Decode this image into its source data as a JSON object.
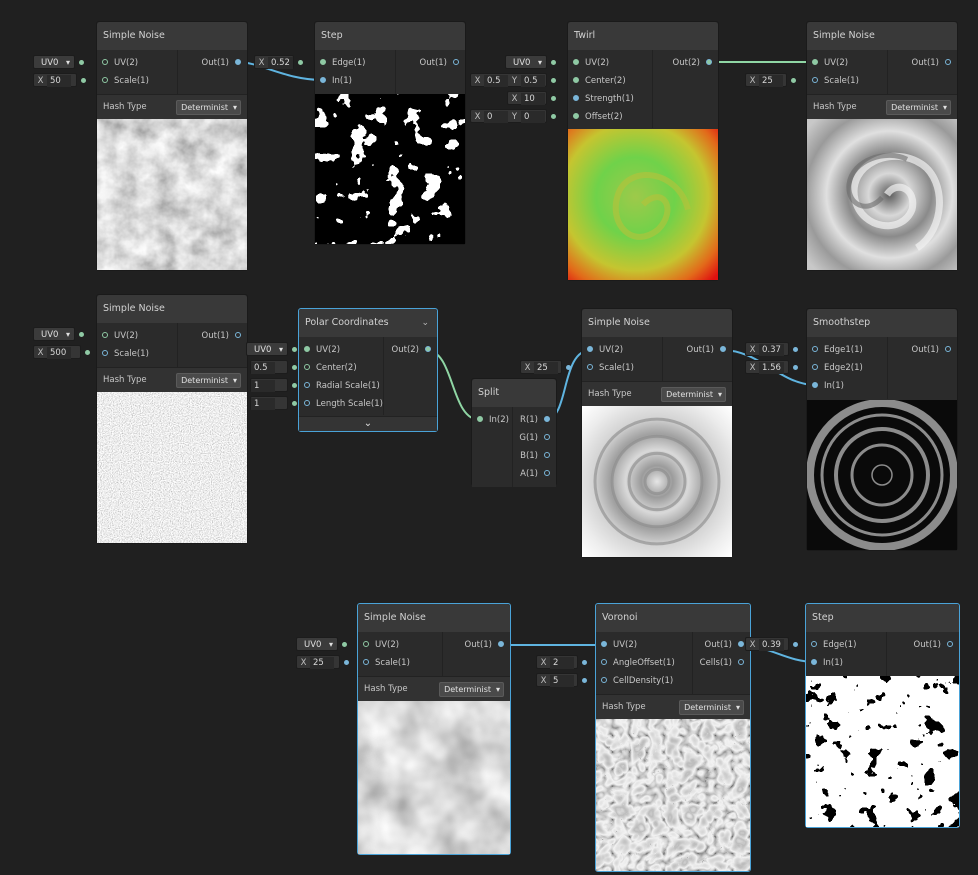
{
  "nodes": {
    "noise1": {
      "title": "Simple Noise",
      "in": [
        "UV(2)",
        "Scale(1)"
      ],
      "out": "Out(1)",
      "hash_label": "Hash Type",
      "hash_value": "Determinist"
    },
    "step1": {
      "title": "Step",
      "in": [
        "Edge(1)",
        "In(1)"
      ],
      "out": "Out(1)"
    },
    "twirl": {
      "title": "Twirl",
      "in": [
        "UV(2)",
        "Center(2)",
        "Strength(1)",
        "Offset(2)"
      ],
      "out": "Out(2)"
    },
    "noise2": {
      "title": "Simple Noise",
      "in": [
        "UV(2)",
        "Scale(1)"
      ],
      "out": "Out(1)",
      "hash_label": "Hash Type",
      "hash_value": "Determinist"
    },
    "noise3": {
      "title": "Simple Noise",
      "in": [
        "UV(2)",
        "Scale(1)"
      ],
      "out": "Out(1)",
      "hash_label": "Hash Type",
      "hash_value": "Determinist"
    },
    "polar": {
      "title": "Polar Coordinates",
      "in": [
        "UV(2)",
        "Center(2)",
        "Radial Scale(1)",
        "Length Scale(1)"
      ],
      "out": "Out(2)"
    },
    "split": {
      "title": "Split",
      "in": [
        "In(2)"
      ],
      "outs": [
        "R(1)",
        "G(1)",
        "B(1)",
        "A(1)"
      ]
    },
    "noise4": {
      "title": "Simple Noise",
      "in": [
        "UV(2)",
        "Scale(1)"
      ],
      "out": "Out(1)",
      "hash_label": "Hash Type",
      "hash_value": "Determinist"
    },
    "smooth": {
      "title": "Smoothstep",
      "in": [
        "Edge1(1)",
        "Edge2(1)",
        "In(1)"
      ],
      "out": "Out(1)"
    },
    "noise5": {
      "title": "Simple Noise",
      "in": [
        "UV(2)",
        "Scale(1)"
      ],
      "out": "Out(1)",
      "hash_label": "Hash Type",
      "hash_value": "Determinist"
    },
    "voronoi": {
      "title": "Voronoi",
      "in": [
        "UV(2)",
        "AngleOffset(1)",
        "CellDensity(1)"
      ],
      "outs": [
        "Out(1)",
        "Cells(1)"
      ],
      "hash_label": "Hash Type",
      "hash_value": "Determinist"
    },
    "step2": {
      "title": "Step",
      "in": [
        "Edge(1)",
        "In(1)"
      ],
      "out": "Out(1)"
    }
  },
  "fields": {
    "n1_uv": "UV0",
    "n1_scale_ax": "X",
    "n1_scale": "50",
    "s1_edge_ax": "X",
    "s1_edge": "0.52",
    "tw_uv": "UV0",
    "tw_cx_ax": "X",
    "tw_cx": "0.5",
    "tw_cy_ax": "Y",
    "tw_cy": "0.5",
    "tw_str_ax": "X",
    "tw_str": "10",
    "tw_ox_ax": "X",
    "tw_ox": "0",
    "tw_oy_ax": "Y",
    "tw_oy": "0",
    "n2_scale_ax": "X",
    "n2_scale": "25",
    "n3_uv": "UV0",
    "n3_scale_ax": "X",
    "n3_scale": "500",
    "po_uv": "UV0",
    "po_center": "0.5",
    "po_radial": "1",
    "po_length": "1",
    "n4_scale_ax": "X",
    "n4_scale": "25",
    "sm_e1_ax": "X",
    "sm_e1": "0.37",
    "sm_e2_ax": "X",
    "sm_e2": "1.56",
    "n5_uv": "UV0",
    "n5_scale_ax": "X",
    "n5_scale": "25",
    "vo_angle_ax": "X",
    "vo_angle": "2",
    "vo_density_ax": "X",
    "vo_density": "5",
    "s2_edge_ax": "X",
    "s2_edge": "0.39"
  },
  "colors": {
    "background": "#202020",
    "node_body": "#2b2b2b",
    "node_header": "#393939",
    "wire_green": "#8fd6a4",
    "wire_blue": "#5fb4e0",
    "selection": "#4aa3d8"
  }
}
